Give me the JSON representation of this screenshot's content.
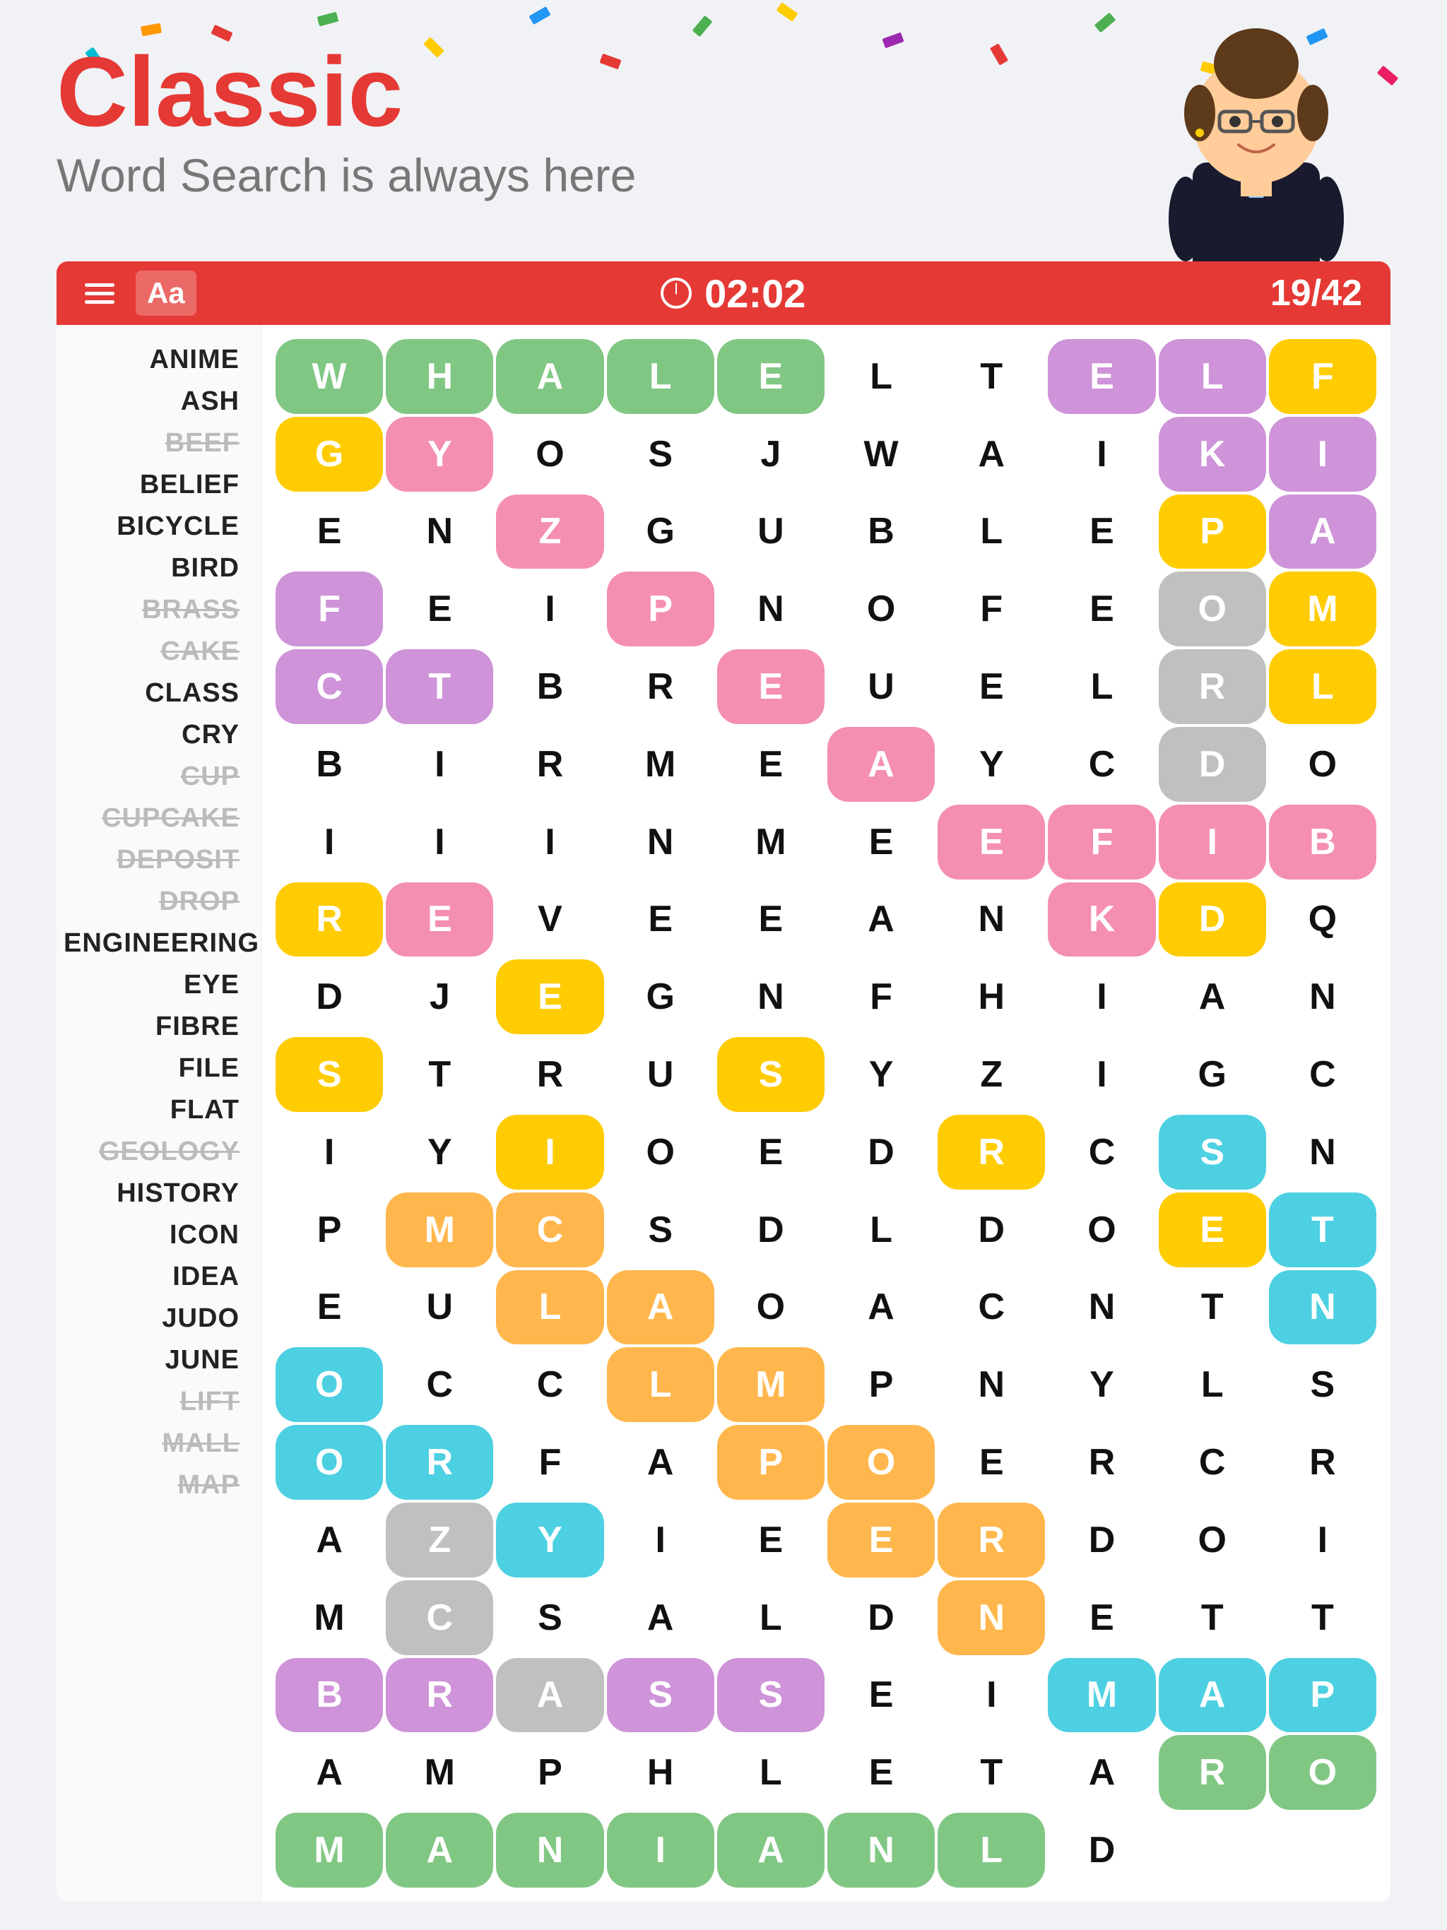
{
  "app": {
    "title": "Classic",
    "subtitle": "Word Search is always here"
  },
  "toolbar": {
    "timer": "02:02",
    "progress": "19/42",
    "font_label": "Aa"
  },
  "words": [
    {
      "text": "ANIME",
      "found": false
    },
    {
      "text": "ASH",
      "found": false
    },
    {
      "text": "BEEF",
      "found": true
    },
    {
      "text": "BELIEF",
      "found": false
    },
    {
      "text": "BICYCLE",
      "found": false
    },
    {
      "text": "BIRD",
      "found": false
    },
    {
      "text": "BRASS",
      "found": true
    },
    {
      "text": "CAKE",
      "found": true
    },
    {
      "text": "CLASS",
      "found": false
    },
    {
      "text": "CRY",
      "found": false
    },
    {
      "text": "CUP",
      "found": true
    },
    {
      "text": "CUPCAKE",
      "found": true
    },
    {
      "text": "DEPOSIT",
      "found": true
    },
    {
      "text": "DROP",
      "found": true
    },
    {
      "text": "ENGINEERING",
      "found": false
    },
    {
      "text": "EYE",
      "found": false
    },
    {
      "text": "FIBRE",
      "found": false
    },
    {
      "text": "FILE",
      "found": false
    },
    {
      "text": "FLAT",
      "found": false
    },
    {
      "text": "GEOLOGY",
      "found": true
    },
    {
      "text": "HISTORY",
      "found": false
    },
    {
      "text": "ICON",
      "found": false
    },
    {
      "text": "IDEA",
      "found": false
    },
    {
      "text": "JUDO",
      "found": false
    },
    {
      "text": "JUNE",
      "found": false
    },
    {
      "text": "LIFT",
      "found": true
    },
    {
      "text": "MALL",
      "found": true
    },
    {
      "text": "MAP",
      "found": true
    }
  ],
  "grid": {
    "rows": [
      [
        "W",
        "H",
        "A",
        "L",
        "E",
        "L",
        "T",
        "E",
        "L",
        "F",
        "G"
      ],
      [
        "Y",
        "O",
        "S",
        "J",
        "W",
        "A",
        "I",
        "K",
        "I",
        "E",
        "N"
      ],
      [
        "Z",
        "G",
        "U",
        "B",
        "L",
        "E",
        "P",
        "A",
        "F",
        "E",
        "I"
      ],
      [
        "P",
        "N",
        "O",
        "F",
        "E",
        "O",
        "M",
        "C",
        "T",
        "B",
        "R"
      ],
      [
        "E",
        "U",
        "E",
        "L",
        "R",
        "L",
        "B",
        "I",
        "R",
        "M",
        "E"
      ],
      [
        "A",
        "Y",
        "C",
        "D",
        "O",
        "I",
        "I",
        "I",
        "N",
        "M",
        "E"
      ],
      [
        "E",
        "F",
        "I",
        "B",
        "R",
        "E",
        "V",
        "E",
        "E",
        "A",
        "N"
      ],
      [
        "K",
        "D",
        "Q",
        "D",
        "J",
        "E",
        "G",
        "N",
        "F",
        "H",
        "I"
      ],
      [
        "A",
        "N",
        "S",
        "T",
        "R",
        "U",
        "S",
        "Y",
        "Z",
        "I",
        "G"
      ],
      [
        "C",
        "I",
        "Y",
        "I",
        "O",
        "E",
        "D",
        "R",
        "C",
        "S",
        "N"
      ],
      [
        "P",
        "M",
        "C",
        "S",
        "D",
        "L",
        "D",
        "O",
        "E",
        "T",
        "E"
      ],
      [
        "U",
        "L",
        "A",
        "O",
        "A",
        "C",
        "N",
        "T",
        "N",
        "O",
        "C"
      ],
      [
        "C",
        "L",
        "M",
        "P",
        "N",
        "Y",
        "L",
        "S",
        "O",
        "R",
        "F"
      ],
      [
        "A",
        "P",
        "O",
        "E",
        "R",
        "C",
        "R",
        "A",
        "Z",
        "Y",
        "I"
      ],
      [
        "E",
        "E",
        "R",
        "D",
        "O",
        "I",
        "M",
        "C",
        "S",
        "A",
        "L"
      ],
      [
        "D",
        "N",
        "E",
        "T",
        "T",
        "B",
        "R",
        "A",
        "S",
        "S",
        "E"
      ],
      [
        "I",
        "M",
        "A",
        "P",
        "A",
        "M",
        "P",
        "H",
        "L",
        "E",
        "T"
      ],
      [
        "A",
        "R",
        "O",
        "M",
        "A",
        "N",
        "I",
        "A",
        "N",
        "L",
        "D"
      ]
    ]
  },
  "colors": {
    "primary_red": "#e53935",
    "background": "#f0f2f5",
    "green_highlight": "#81c784",
    "pink_highlight": "#f48fb1",
    "purple_highlight": "#ce93d8",
    "yellow_highlight": "#ffcc02",
    "cyan_highlight": "#4dd0e1",
    "orange_highlight": "#ffb74d"
  }
}
